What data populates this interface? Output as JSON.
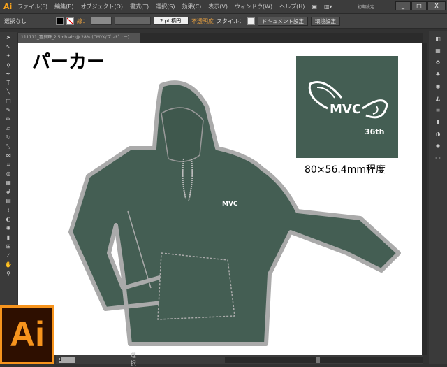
{
  "app": {
    "logo": "Ai",
    "big_logo": "Ai"
  },
  "menu": [
    "ファイル(F)",
    "編集(E)",
    "オブジェクト(O)",
    "書式(T)",
    "選択(S)",
    "効果(C)",
    "表示(V)",
    "ウィンドウ(W)",
    "ヘルプ(H)"
  ],
  "workspace": "初期設定",
  "window_buttons": [
    "_",
    "□",
    "X"
  ],
  "control": {
    "selection": "選択なし",
    "stroke_label": "線：",
    "stroke_size": "2 pt 楕円",
    "opacity_label": "不透明度",
    "style_label": "スタイル：",
    "doc_settings": "ドキュメント設定",
    "prefs": "環境設定"
  },
  "document_tab": "111111_富良野_2.5mh.ai* @ 28% (CMYK/プレビュー)",
  "artboard": {
    "title": "パーカー",
    "logo_text": "MVC",
    "logo_sub": "36th",
    "caption": "80×56.4mm程度",
    "garment_color": "#445e53"
  },
  "status": {
    "zoom": "1",
    "mode": "選択"
  }
}
